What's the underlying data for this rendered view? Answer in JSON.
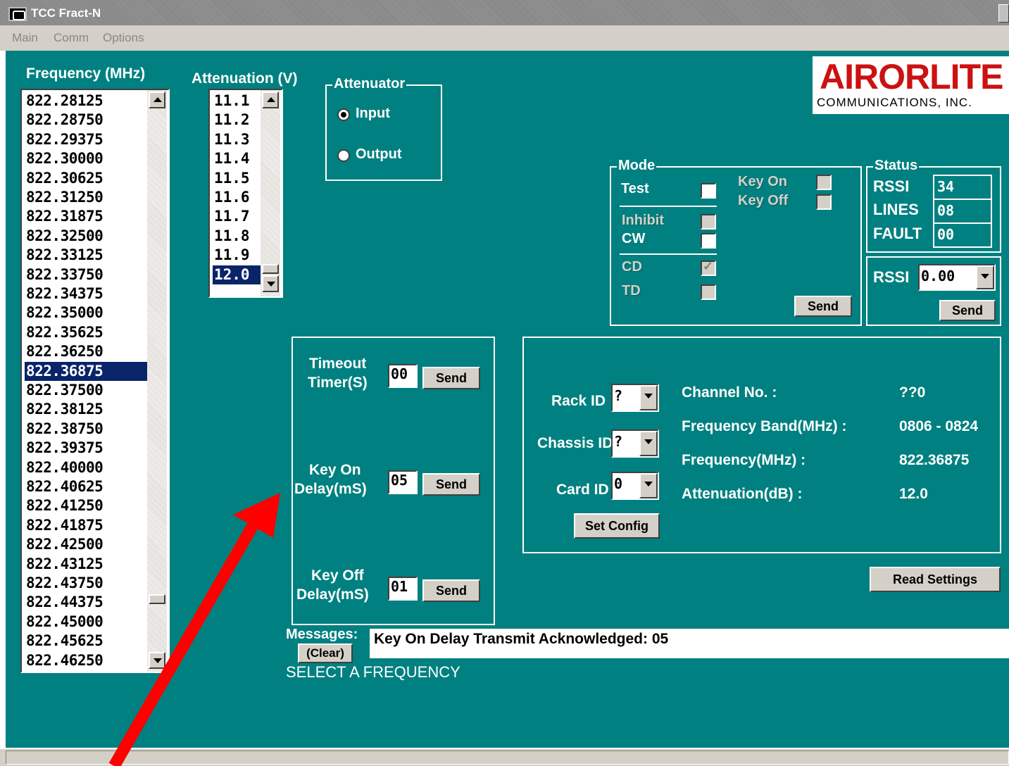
{
  "window": {
    "title": "TCC Fract-N"
  },
  "menu": {
    "items": [
      "Main",
      "Comm",
      "Options"
    ]
  },
  "frequency": {
    "label": "Frequency (MHz)",
    "items": [
      "822.28125",
      "822.28750",
      "822.29375",
      "822.30000",
      "822.30625",
      "822.31250",
      "822.31875",
      "822.32500",
      "822.33125",
      "822.33750",
      "822.34375",
      "822.35000",
      "822.35625",
      "822.36250",
      "822.36875",
      "822.37500",
      "822.38125",
      "822.38750",
      "822.39375",
      "822.40000",
      "822.40625",
      "822.41250",
      "822.41875",
      "822.42500",
      "822.43125",
      "822.43750",
      "822.44375",
      "822.45000",
      "822.45625",
      "822.46250"
    ],
    "selected": "822.36875"
  },
  "attenuation": {
    "label": "Attenuation (V)",
    "items": [
      "11.1",
      "11.2",
      "11.3",
      "11.4",
      "11.5",
      "11.6",
      "11.7",
      "11.8",
      "11.9",
      "12.0"
    ],
    "selected": "12.0"
  },
  "attenuator": {
    "title": "Attenuator",
    "input_label": "Input",
    "output_label": "Output",
    "selected": "Input"
  },
  "logo": {
    "brand": "AIRORLITE",
    "sub": "COMMUNICATIONS, INC.",
    "brand_color": "#cc1111"
  },
  "mode": {
    "title": "Mode",
    "test_label": "Test",
    "inhibit_label": "Inhibit",
    "cw_label": "CW",
    "cd_label": "CD",
    "td_label": "TD",
    "key_on_label": "Key On",
    "key_off_label": "Key Off",
    "cd_checked": true,
    "send_label": "Send"
  },
  "status": {
    "title": "Status",
    "rssi_label": "RSSI",
    "rssi_value": "34",
    "lines_label": "LINES",
    "lines_value": "08",
    "fault_label": "FAULT",
    "fault_value": "00"
  },
  "rssi_select": {
    "label": "RSSI",
    "value": "0.00",
    "send_label": "Send"
  },
  "timers": {
    "timeout_label_1": "Timeout",
    "timeout_label_2": "Timer(S)",
    "timeout_value": "00",
    "key_on_label_1": "Key On",
    "key_on_label_2": "Delay(mS)",
    "key_on_value": "05",
    "key_off_label_1": "Key Off",
    "key_off_label_2": "Delay(mS)",
    "key_off_value": "01",
    "send_label": "Send"
  },
  "config": {
    "rack_label": "Rack ID",
    "rack_value": "?",
    "chassis_label": "Chassis ID",
    "chassis_value": "?",
    "card_label": "Card ID",
    "card_value": "0",
    "set_config_label": "Set Config",
    "channel_label": "Channel No. :",
    "channel_value": "??0",
    "band_label": "Frequency Band(MHz) :",
    "band_value": "0806 - 0824",
    "freq_label": "Frequency(MHz) :",
    "freq_value": "822.36875",
    "att_label": "Attenuation(dB) :",
    "att_value": "12.0"
  },
  "read_settings_label": "Read Settings",
  "messages": {
    "label": "Messages:",
    "clear_label": "(Clear)",
    "text": "Key On Delay Transmit Acknowledged: 05",
    "prompt": "SELECT A FREQUENCY"
  },
  "annotation": {
    "color": "#ff0000"
  }
}
